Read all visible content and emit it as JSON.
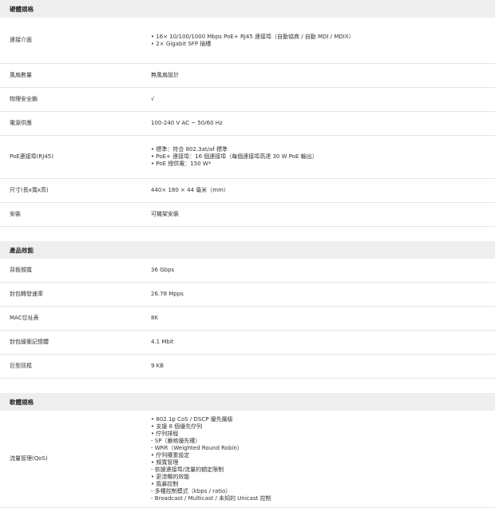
{
  "sections": [
    {
      "title": "硬體規格",
      "rows": [
        {
          "label": "連接介面",
          "lines": [
            "• 16× 10/100/1000 Mbps PoE+ RJ45 連接埠（自動協商 / 自動 MDI / MDIX）",
            "• 2× Gigabit SFP 插槽"
          ]
        },
        {
          "label": "風扇數量",
          "lines": [
            "無風扇設計"
          ]
        },
        {
          "label": "物理安全鎖",
          "lines": [
            "√"
          ]
        },
        {
          "label": "電源供應",
          "lines": [
            "100-240 V AC ~ 50/60 Hz"
          ]
        },
        {
          "label": "PoE連接埠(RJ45)",
          "lines": [
            "• 標準：符合 802.3at/af 標準",
            "• PoE+ 連接埠：16 個連接埠（每個連接埠高達 30 W PoE 輸出）",
            "• PoE 總供電：150 W*"
          ]
        },
        {
          "label": "尺寸(長x寬x高)",
          "lines": [
            "440× 180 × 44 毫米（mm）"
          ]
        },
        {
          "label": "安裝",
          "lines": [
            "可機架安裝"
          ]
        }
      ]
    },
    {
      "title": "產品效能",
      "rows": [
        {
          "label": "背板頻寬",
          "lines": [
            "36 Gbps"
          ]
        },
        {
          "label": "封包轉發速率",
          "lines": [
            "26.78 Mpps"
          ]
        },
        {
          "label": "MAC位址表",
          "lines": [
            "8K"
          ]
        },
        {
          "label": "封包緩衝記憶體",
          "lines": [
            "4.1 Mbit"
          ]
        },
        {
          "label": "巨型訊框",
          "lines": [
            "9 KB"
          ]
        }
      ]
    },
    {
      "title": "軟體規格",
      "rows": [
        {
          "label": "流量管理(QoS)",
          "lines": [
            "• 802.1p CoS / DSCP 優先層級",
            "• 支援 8 個優先佇列",
            "• 佇列排程",
            "- SP（嚴格優先權）",
            "- WRR（Weighted Round Robin）",
            "• 佇列權重設定",
            "• 頻寬管理",
            "- 依據連接埠/流量的額定限制",
            "• 更流暢的效能",
            "• 風暴控制",
            "- 多種控制模式（kbps / ratio）",
            "- Broadcast / Multicast / 未知的 Unicast 控制"
          ]
        }
      ]
    }
  ]
}
